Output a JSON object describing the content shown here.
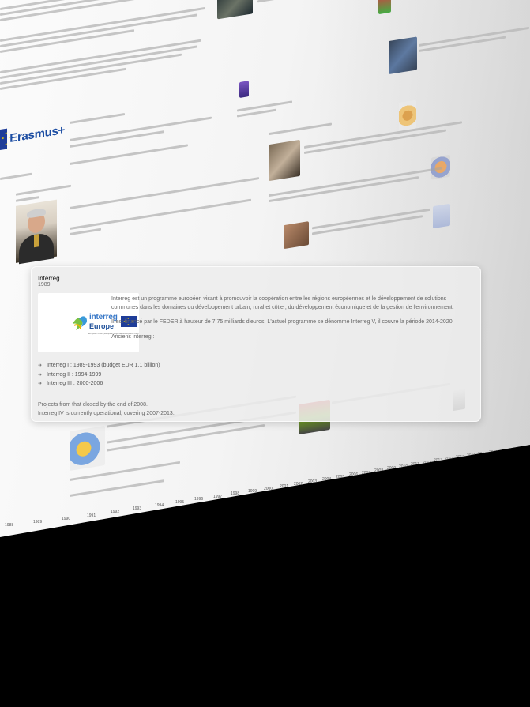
{
  "background": {
    "erasmus_logo_text": "Erasmus+",
    "ruler_years": [
      "1988",
      "1989",
      "1990",
      "1991",
      "1992",
      "1993",
      "1994",
      "1995",
      "1996",
      "1997",
      "1998",
      "1999",
      "2000",
      "2001",
      "2002",
      "2003",
      "2004",
      "2005",
      "2006",
      "2007",
      "2008",
      "2009",
      "2010",
      "2011",
      "2012",
      "2013",
      "2014",
      "2015",
      "2016",
      "2017",
      "2018"
    ]
  },
  "card": {
    "title": "Interreg",
    "year": "1989",
    "logo": {
      "word1": "interreg",
      "word2": "Europe",
      "subtitle": "European Union | European Regional Development Fund"
    },
    "description": [
      "Interreg est un programme européen visant à promouvoir la coopération entre les régions européennes et le développement de solutions communes dans les domaines du développement urbain, rural et côtier, du développement économique et de la gestion de l'environnement.",
      "Il est financé par le FEDER à hauteur de 7,75 milliards d'euros. L'actuel programme se dénomme Interreg V, il couvre la période 2014-2020.",
      "Anciens interreg :"
    ],
    "list": [
      "Interreg I : 1989-1993 (budget EUR 1.1 billion)",
      "Interreg II : 1994-1999",
      "Interreg III : 2000-2006"
    ],
    "footer": [
      "Projects from that closed by the end of 2008.",
      "Interreg IV is currently operational, covering 2007-2013."
    ]
  },
  "colors": {
    "accent_blue": "#1f3d99",
    "flag_star": "#f5d200",
    "card_bg": "#ececec"
  }
}
